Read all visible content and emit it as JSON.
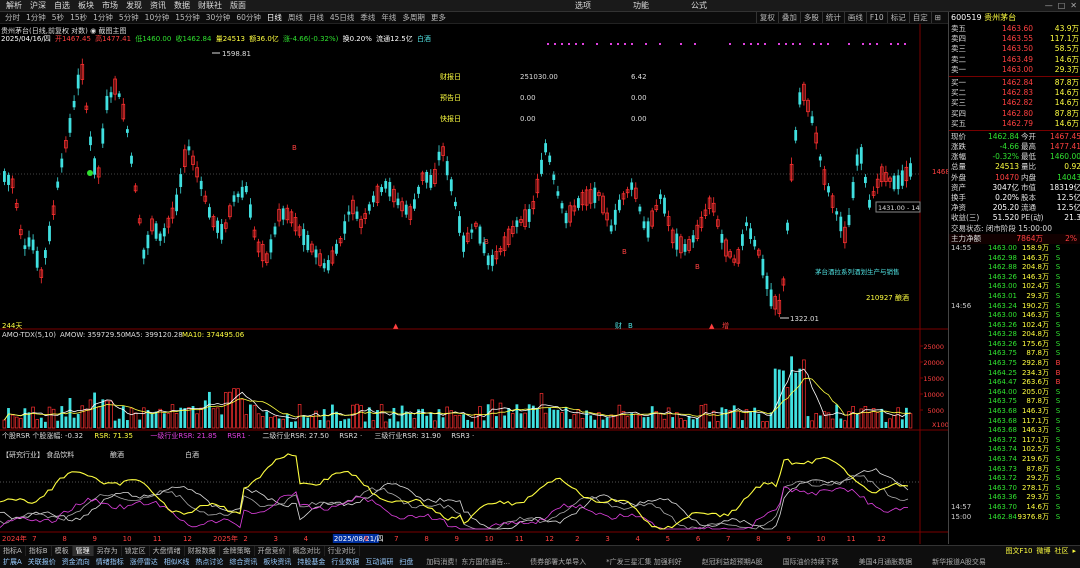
{
  "menu": {
    "items": [
      "解析",
      "沪深",
      "自选",
      "板块",
      "市场",
      "发现",
      "资讯",
      "数据",
      "财联社",
      "版面"
    ],
    "middle": [
      "选项",
      "功能",
      "公式"
    ],
    "window_controls": [
      "—",
      "□",
      "✕"
    ]
  },
  "periods": {
    "items": [
      "分时",
      "1分钟",
      "5秒",
      "15秒",
      "1分钟",
      "5分钟",
      "10分钟",
      "15分钟",
      "30分钟",
      "60分钟",
      "日线",
      "周线",
      "月线",
      "45日线",
      "季线",
      "年线",
      "多周期",
      "更多"
    ],
    "active_index": 10
  },
  "tools": [
    "复权",
    "叠加",
    "多股",
    "统计",
    "画线",
    "F10",
    "标记",
    "自定",
    "⊞"
  ],
  "chart": {
    "title": "贵州茅台(日线,前复权 对数)  ◉ 截图主图",
    "info": {
      "date": "2025/04/16/四",
      "open": "开1467.45",
      "high": "高1477.41",
      "low": "低1460.00",
      "close": "收1462.84",
      "vol": "量24513",
      "amt": "额36.0亿",
      "chg": "涨-4.66(-0.32%)",
      "turn": "换0.20%",
      "float": "流通12.5亿",
      "tag": "白酒"
    },
    "price_labels": {
      "high": "1598.81",
      "low": "1322.01",
      "last": "1468",
      "range": "1431.00 - 14"
    },
    "events": [
      {
        "label": "财报日",
        "value": "251030.00",
        "pct": "6.42"
      },
      {
        "label": "预告日",
        "value": "0.00",
        "pct": "0.00"
      },
      {
        "label": "快报日",
        "value": "0.00",
        "pct": "0.00"
      }
    ],
    "notes": {
      "note1": "茅台酒拉系列酒划生产与销售",
      "note2": "210927 酿酒",
      "days": "244天"
    }
  },
  "amo": {
    "header_name": "AMO-TDX(5,10)",
    "amow": "AMOW: 359729.50",
    "ma5": "MA5: 399120.28",
    "ma10": "MA10: 374495.06",
    "ticks": [
      "25000",
      "20000",
      "15000",
      "10000",
      "5000"
    ],
    "unit": "X100"
  },
  "rsr": {
    "header": "个股RSR 个股涨幅: -0.32",
    "rsr": "RSR: 71.35",
    "l1": "一级行业RSR: 21.85",
    "rsr1": "RSR1 ·",
    "l2": "二级行业RSR: 27.50",
    "rsr2": "RSR2 ·",
    "l3": "三级行业RSR: 31.90",
    "rsr3": "RSR3 ·",
    "industry": "【研究行业】 食品饮料",
    "sub1": "酿酒",
    "sub2": "白酒"
  },
  "xaxis": {
    "labels": [
      "2024年",
      "7",
      "8",
      "9",
      "10",
      "11",
      "12",
      "2025年",
      "2",
      "3",
      "4",
      "2025/08/21/四",
      "6",
      "7",
      "8",
      "9",
      "10",
      "11",
      "12",
      "2",
      "3",
      "4",
      "5",
      "6",
      "7",
      "8",
      "9",
      "10",
      "11",
      "12"
    ]
  },
  "side": {
    "code": "600519",
    "name": "贵州茅台",
    "sells": [
      {
        "label": "卖五",
        "price": "1463.60",
        "vol": "43.9万",
        "flag": "¥"
      },
      {
        "label": "卖四",
        "price": "1463.55",
        "vol": "117.1万",
        "flag": ""
      },
      {
        "label": "卖三",
        "price": "1463.50",
        "vol": "58.5万",
        "flag": ""
      },
      {
        "label": "卖二",
        "price": "1463.49",
        "vol": "14.6万",
        "flag": ""
      },
      {
        "label": "卖一",
        "price": "1463.00",
        "vol": "29.3万",
        "flag": ""
      }
    ],
    "buys": [
      {
        "label": "买一",
        "price": "1462.84",
        "vol": "87.8万"
      },
      {
        "label": "买二",
        "price": "1462.83",
        "vol": "14.6万"
      },
      {
        "label": "买三",
        "price": "1462.82",
        "vol": "14.6万"
      },
      {
        "label": "买四",
        "price": "1462.80",
        "vol": "87.8万"
      },
      {
        "label": "买五",
        "price": "1462.79",
        "vol": "14.6万"
      }
    ],
    "quote": [
      {
        "a": "现价",
        "b": "1462.84",
        "c": "今开",
        "d": "1467.45",
        "bc": "green",
        "dc": "red"
      },
      {
        "a": "涨跌",
        "b": "-4.66",
        "c": "最高",
        "d": "1477.41",
        "bc": "green",
        "dc": "red"
      },
      {
        "a": "涨幅",
        "b": "-0.32%",
        "c": "最低",
        "d": "1460.00",
        "bc": "green",
        "dc": "green"
      },
      {
        "a": "总量",
        "b": "24513",
        "c": "量比",
        "d": "0.92",
        "bc": "yellow",
        "dc": "yellow"
      },
      {
        "a": "外盘",
        "b": "10470",
        "c": "内盘",
        "d": "14043",
        "bc": "red",
        "dc": "green"
      },
      {
        "a": "资产",
        "b": "3047亿",
        "c": "市值",
        "d": "18319亿",
        "bc": "white",
        "dc": "white"
      },
      {
        "a": "换手",
        "b": "0.20%",
        "c": "股本",
        "d": "12.5亿",
        "bc": "white",
        "dc": "white"
      },
      {
        "a": "净资",
        "b": "205.20",
        "c": "流通",
        "d": "12.5亿",
        "bc": "white",
        "dc": "white"
      },
      {
        "a": "收益(三)",
        "b": "51.520",
        "c": "PE(动)",
        "d": "21.3",
        "bc": "white",
        "dc": "white"
      }
    ],
    "status": "交易状态: 闭市阶段 15:00:00",
    "flow": {
      "label": "主力净额",
      "value": "7864万",
      "pct": "2%"
    },
    "ticks": [
      {
        "t": "14:55",
        "p": "1463.00",
        "v": "158.9万",
        "s": "S"
      },
      {
        "t": "",
        "p": "1462.98",
        "v": "146.3万",
        "s": "S"
      },
      {
        "t": "",
        "p": "1462.88",
        "v": "204.8万",
        "s": "S"
      },
      {
        "t": "",
        "p": "1463.26",
        "v": "146.3万",
        "s": "S"
      },
      {
        "t": "",
        "p": "1463.00",
        "v": "102.4万",
        "s": "S"
      },
      {
        "t": "",
        "p": "1463.01",
        "v": "29.3万",
        "s": "S"
      },
      {
        "t": "14:56",
        "p": "1463.24",
        "v": "190.2万",
        "s": "S"
      },
      {
        "t": "",
        "p": "1463.00",
        "v": "146.3万",
        "s": "S"
      },
      {
        "t": "",
        "p": "1463.26",
        "v": "102.4万",
        "s": "S"
      },
      {
        "t": "",
        "p": "1463.28",
        "v": "204.8万",
        "s": "S"
      },
      {
        "t": "",
        "p": "1463.26",
        "v": "175.6万",
        "s": "S"
      },
      {
        "t": "",
        "p": "1463.75",
        "v": "87.8万",
        "s": "S"
      },
      {
        "t": "",
        "p": "1463.75",
        "v": "292.8万",
        "s": "B"
      },
      {
        "t": "",
        "p": "1464.25",
        "v": "234.3万",
        "s": "B"
      },
      {
        "t": "",
        "p": "1464.47",
        "v": "263.6万",
        "s": "B"
      },
      {
        "t": "",
        "p": "1464.00",
        "v": "205.0万",
        "s": "S"
      },
      {
        "t": "",
        "p": "1463.75",
        "v": "87.8万",
        "s": "S"
      },
      {
        "t": "",
        "p": "1463.68",
        "v": "146.3万",
        "s": "S"
      },
      {
        "t": "",
        "p": "1463.68",
        "v": "117.1万",
        "s": "S"
      },
      {
        "t": "",
        "p": "1463.68",
        "v": "146.3万",
        "s": "S"
      },
      {
        "t": "",
        "p": "1463.72",
        "v": "117.1万",
        "s": "S"
      },
      {
        "t": "",
        "p": "1463.74",
        "v": "102.5万",
        "s": "S"
      },
      {
        "t": "",
        "p": "1463.74",
        "v": "219.6万",
        "s": "S"
      },
      {
        "t": "",
        "p": "1463.73",
        "v": "87.8万",
        "s": "S"
      },
      {
        "t": "",
        "p": "1463.72",
        "v": "29.2万",
        "s": "S"
      },
      {
        "t": "",
        "p": "1463.70",
        "v": "278.1万",
        "s": "S"
      },
      {
        "t": "",
        "p": "1463.36",
        "v": "29.3万",
        "s": "S"
      },
      {
        "t": "14:57",
        "p": "1463.70",
        "v": "14.6万",
        "s": "S"
      },
      {
        "t": "15:00",
        "p": "1462.84",
        "v": "9376.8万",
        "s": "S"
      }
    ]
  },
  "bottom": {
    "tabs": [
      "指标A",
      "指标B",
      "模板",
      "管理",
      "另存为",
      "锁定区",
      "大盘情绪",
      "财报数据",
      "金牌策略",
      "开盘竞价",
      "概念对比",
      "行业对比"
    ],
    "tabs2": [
      "扩展A",
      "关联报价",
      "资金流向",
      "情绪指标",
      "涨停雷达",
      "相似K线",
      "热点讨论",
      "综合资讯",
      "板块资讯",
      "持股基金",
      "行业数据",
      "互动调研",
      "扫盘"
    ],
    "right": [
      "图文F10",
      "微博",
      "社区",
      "▸"
    ],
    "news": [
      "加码消费！东方国信通告...",
      "债券部署大单导入",
      "*广发三星汇集 加强利好",
      "赵冠利益超预期A股",
      "国际油价持续下跌",
      "美国4月通胀数据",
      "新华报道A股交易"
    ]
  }
}
